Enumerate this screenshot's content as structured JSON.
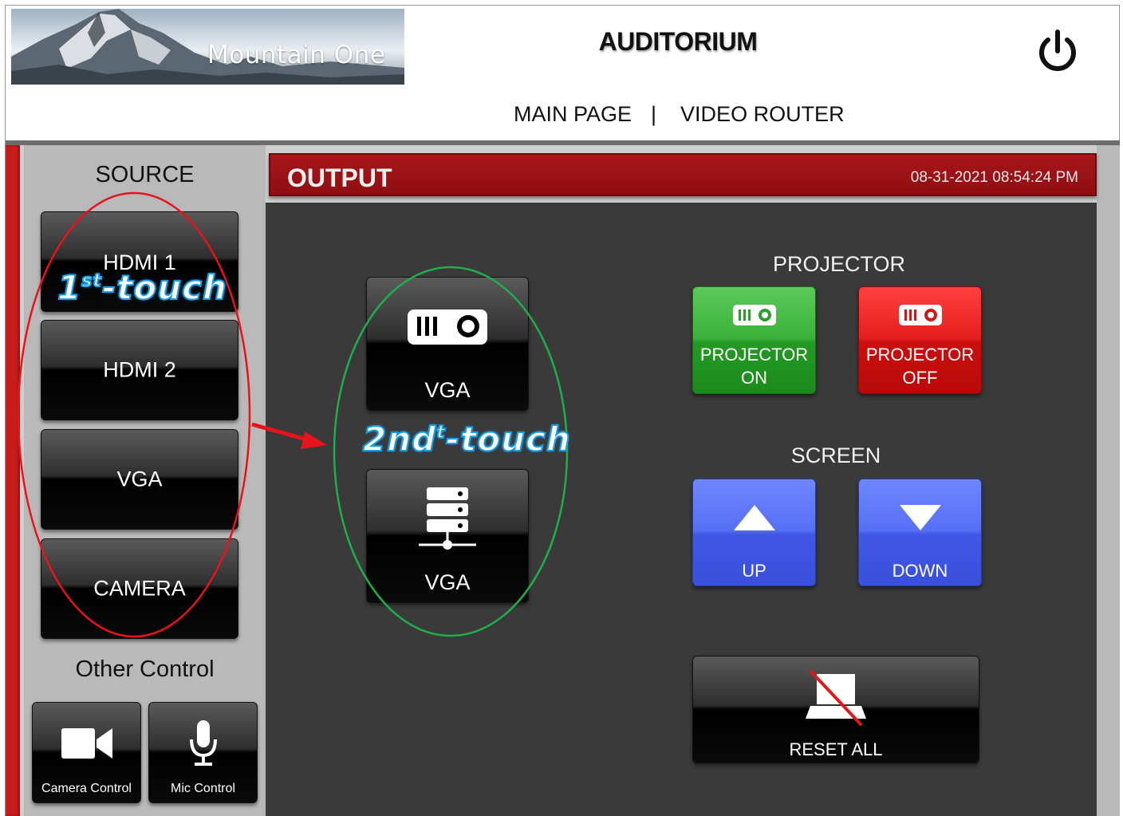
{
  "header": {
    "logo_text": "Mountain One",
    "title": "AUDITORIUM",
    "power_icon": "power-icon"
  },
  "nav": {
    "items": [
      "MAIN PAGE",
      "VIDEO ROUTER"
    ],
    "separator": "|"
  },
  "sidebar": {
    "source_title": "SOURCE",
    "sources": [
      "HDMI 1",
      "HDMI 2",
      "VGA",
      "CAMERA"
    ],
    "other_title": "Other Control",
    "other_controls": [
      {
        "label": "Camera Control",
        "icon": "video-camera-icon"
      },
      {
        "label": "Mic Control",
        "icon": "microphone-icon"
      }
    ]
  },
  "main": {
    "output_title": "OUTPUT",
    "datetime": "08-31-2021 08:54:24 PM",
    "outputs": [
      {
        "label": "VGA",
        "icon": "projector-icon"
      },
      {
        "label": "VGA",
        "icon": "server-icon"
      }
    ],
    "projector": {
      "title": "PROJECTOR",
      "on_line1": "PROJECTOR",
      "on_line2": "ON",
      "off_line1": "PROJECTOR",
      "off_line2": "OFF"
    },
    "screen": {
      "title": "SCREEN",
      "up": "UP",
      "down": "DOWN"
    },
    "reset_label": "RESET ALL"
  },
  "annotations": {
    "first_touch": {
      "main": "1",
      "sup": "st",
      "rest": "-touch"
    },
    "second_touch": {
      "main": "2nd",
      "sup": "t",
      "rest": "-touch"
    }
  },
  "colors": {
    "accent_red": "#c91d1d",
    "output_bar": "#a8161a",
    "green": "#3bb23a",
    "red": "#e61e1e",
    "blue": "#5670f6",
    "annotation_red": "#e8131b",
    "annotation_green": "#1fae4b"
  }
}
